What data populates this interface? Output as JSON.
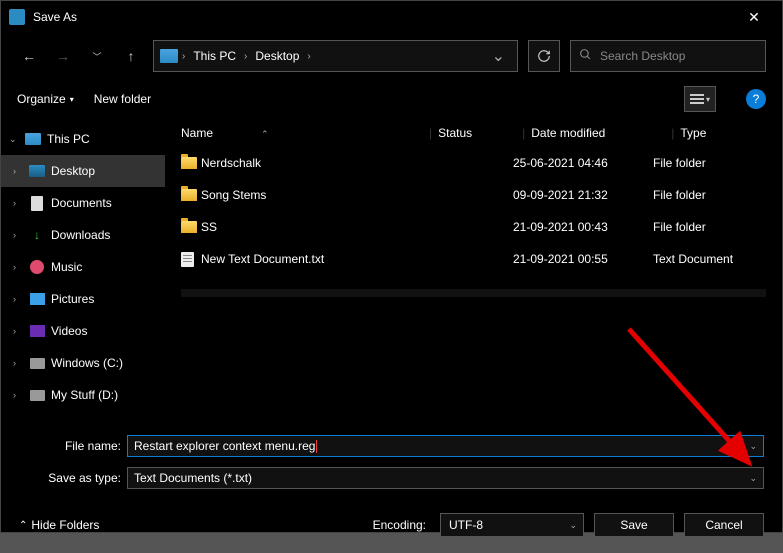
{
  "titlebar": {
    "title": "Save As"
  },
  "breadcrumb": {
    "seg1": "This PC",
    "seg2": "Desktop"
  },
  "search": {
    "placeholder": "Search Desktop"
  },
  "toolbar": {
    "organize": "Organize",
    "newfolder": "New folder"
  },
  "sidebar": {
    "root": "This PC",
    "items": [
      {
        "label": "Desktop"
      },
      {
        "label": "Documents"
      },
      {
        "label": "Downloads"
      },
      {
        "label": "Music"
      },
      {
        "label": "Pictures"
      },
      {
        "label": "Videos"
      },
      {
        "label": "Windows (C:)"
      },
      {
        "label": "My Stuff (D:)"
      }
    ]
  },
  "columns": {
    "name": "Name",
    "status": "Status",
    "date": "Date modified",
    "type": "Type"
  },
  "files": [
    {
      "name": "Nerdschalk",
      "date": "25-06-2021 04:46",
      "type": "File folder",
      "kind": "folder"
    },
    {
      "name": "Song Stems",
      "date": "09-09-2021 21:32",
      "type": "File folder",
      "kind": "folder"
    },
    {
      "name": "SS",
      "date": "21-09-2021 00:43",
      "type": "File folder",
      "kind": "folder"
    },
    {
      "name": "New Text Document.txt",
      "date": "21-09-2021 00:55",
      "type": "Text Document",
      "kind": "txt"
    }
  ],
  "filename": {
    "label": "File name:",
    "value": "Restart explorer context menu.reg"
  },
  "saveastype": {
    "label": "Save as type:",
    "value": "Text Documents (*.txt)"
  },
  "footer": {
    "hidefolders": "Hide Folders",
    "encoding_label": "Encoding:",
    "encoding_value": "UTF-8",
    "save": "Save",
    "cancel": "Cancel"
  }
}
